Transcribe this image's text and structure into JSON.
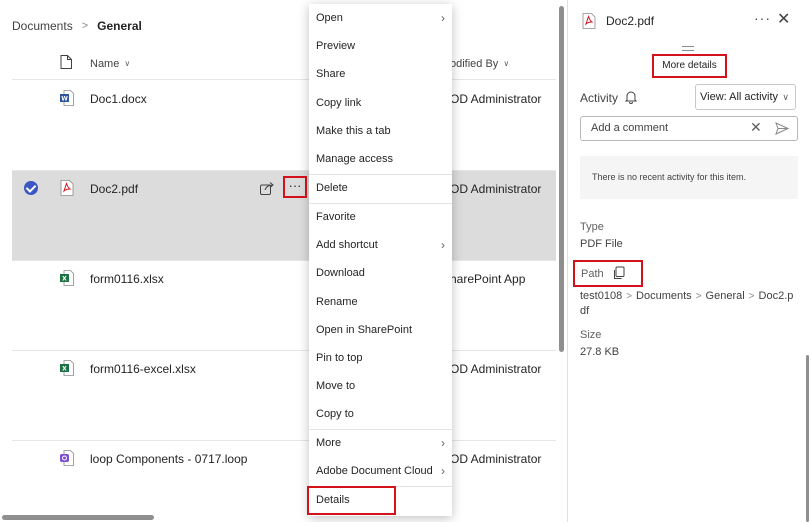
{
  "breadcrumb": {
    "root": "Documents",
    "current": "General"
  },
  "list_header": {
    "name": "Name",
    "modified_by": "odified By"
  },
  "files": [
    {
      "name": "Doc1.docx",
      "type": "word",
      "modified_by": "OD Administrator",
      "selected": false
    },
    {
      "name": "Doc2.pdf",
      "type": "pdf",
      "modified_by": "OD Administrator",
      "selected": true
    },
    {
      "name": "form0116.xlsx",
      "type": "excel",
      "modified_by": "harePoint App",
      "selected": false
    },
    {
      "name": "form0116-excel.xlsx",
      "type": "excel",
      "modified_by": "OD Administrator",
      "selected": false
    },
    {
      "name": "loop Components - 0717.loop",
      "type": "loop",
      "modified_by": "OD Administrator",
      "selected": false
    }
  ],
  "row_actions": {
    "more": "···"
  },
  "context_menu": {
    "items": [
      {
        "label": "Open",
        "has_submenu": true
      },
      {
        "label": "Preview",
        "has_submenu": false
      },
      {
        "label": "Share",
        "has_submenu": false
      },
      {
        "label": "Copy link",
        "has_submenu": false
      },
      {
        "label": "Make this a tab",
        "has_submenu": false
      },
      {
        "label": "Manage access",
        "has_submenu": false
      },
      {
        "label": "Delete",
        "has_submenu": false
      },
      {
        "label": "Favorite",
        "has_submenu": false
      },
      {
        "label": "Add shortcut",
        "has_submenu": true
      },
      {
        "label": "Download",
        "has_submenu": false
      },
      {
        "label": "Rename",
        "has_submenu": false
      },
      {
        "label": "Open in SharePoint",
        "has_submenu": false
      },
      {
        "label": "Pin to top",
        "has_submenu": false
      },
      {
        "label": "Move to",
        "has_submenu": false
      },
      {
        "label": "Copy to",
        "has_submenu": false
      },
      {
        "label": "More",
        "has_submenu": true
      },
      {
        "label": "Adobe Document Cloud",
        "has_submenu": true
      },
      {
        "label": "Details",
        "has_submenu": false
      }
    ]
  },
  "details_panel": {
    "title": "Doc2.pdf",
    "more_details": "More details",
    "activity_label": "Activity",
    "view_filter": "View: All activity",
    "comment_placeholder": "Add a comment",
    "no_activity": "There is no recent activity for this item.",
    "type_label": "Type",
    "type_value": "PDF File",
    "path_label": "Path",
    "path": [
      "test0108",
      "Documents",
      "General",
      "Doc2.p",
      "df"
    ],
    "size_label": "Size",
    "size_value": "27.8 KB"
  },
  "icons": {
    "word": "word-file-icon",
    "pdf": "pdf-file-icon",
    "excel": "excel-file-icon",
    "loop": "loop-file-icon",
    "share": "share-icon",
    "bell": "bell-icon",
    "copy": "copy-icon",
    "send": "send-icon",
    "close": "close-icon"
  },
  "colors": {
    "accent": "#3a57c4",
    "highlight_box": "#d4121c",
    "selected_row": "#dcdcdc",
    "word": "#2b579a",
    "pdf": "#d4121c",
    "excel": "#1e7145",
    "loop": "#7a4fd4"
  }
}
